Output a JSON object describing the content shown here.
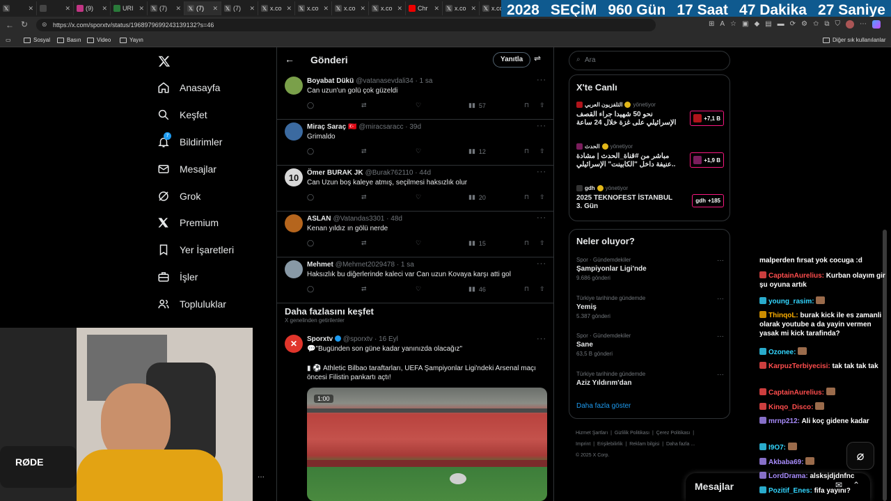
{
  "browser": {
    "tabs": [
      {
        "label": "",
        "icon": "x-logo"
      },
      {
        "label": "",
        "icon": "tabs"
      },
      {
        "label": "(9)",
        "icon": "instagram"
      },
      {
        "label": "URI",
        "icon": "shield"
      },
      {
        "label": "(7)",
        "icon": "x-logo"
      },
      {
        "label": "(7)",
        "icon": "x-logo"
      },
      {
        "label": "(7)",
        "icon": "x-logo"
      },
      {
        "label": "x.co",
        "icon": "x-logo"
      },
      {
        "label": "x.co",
        "icon": "x-logo"
      },
      {
        "label": "x.co",
        "icon": "x-logo"
      },
      {
        "label": "x.co",
        "icon": "x-logo"
      },
      {
        "label": "Chr",
        "icon": "youtube"
      },
      {
        "label": "x.co",
        "icon": "x-logo"
      },
      {
        "label": "x.co",
        "icon": "x-logo"
      }
    ],
    "url": "https://x.com/sporxtv/status/1968979699243139132?s=46",
    "bookmarks": [
      "Sosyal",
      "Basın",
      "Video",
      "Yayın"
    ],
    "other_bookmarks": "Diğer sık kullanılanlar"
  },
  "countdown": {
    "year": "2028",
    "label": "SEÇİM",
    "days": "960 Gün",
    "hours": "17 Saat",
    "minutes": "47 Dakika",
    "seconds": "27 Saniye"
  },
  "nav": {
    "items": [
      {
        "label": "Anasayfa",
        "icon": "home-icon"
      },
      {
        "label": "Keşfet",
        "icon": "search-icon"
      },
      {
        "label": "Bildirimler",
        "icon": "bell-icon",
        "badge": "7"
      },
      {
        "label": "Mesajlar",
        "icon": "mail-icon"
      },
      {
        "label": "Grok",
        "icon": "grok-icon"
      },
      {
        "label": "Premium",
        "icon": "x-premium-icon"
      },
      {
        "label": "Yer İşaretleri",
        "icon": "bookmark-icon"
      },
      {
        "label": "İşler",
        "icon": "briefcase-icon"
      },
      {
        "label": "Topluluklar",
        "icon": "people-icon"
      }
    ]
  },
  "header": {
    "title": "Gönderi",
    "reply_button": "Yanıtla"
  },
  "replies": [
    {
      "name": "Boyabat Dükü",
      "handle": "@vatanasevdali34 · 1 sa",
      "text": "Can uzun'un golü çok güzeldi",
      "views": "57",
      "avatar_color": "#7aa04a"
    },
    {
      "name": "Miraç Saraç",
      "flag": "🇹🇷",
      "handle": "@miracsaracc · 39d",
      "text": "Grimaldo",
      "views": "12",
      "avatar_color": "#3b6aa0"
    },
    {
      "name": "Ömer BURAK JK",
      "handle": "@Burak762110 · 44d",
      "text": "Can Uzun boş kaleye atmış, seçilmesi haksızlık olur",
      "views": "20",
      "avatar_color": "#d8d8d8",
      "avatar_text": "10"
    },
    {
      "name": "ASLAN",
      "handle": "@Vatandas3301 · 48d",
      "text": "Kenan yıldız ın gölü nerde",
      "views": "15",
      "avatar_color": "#b5651d"
    },
    {
      "name": "Mehmet",
      "handle": "@Mehmet2029478 · 1 sa",
      "text": "Haksızlık bu diğerlerinde kaleci var Can uzun Kovaya karşı atti gol",
      "views": "46",
      "avatar_color": "#8899a6"
    }
  ],
  "discover": {
    "title": "Daha fazlasını keşfet",
    "subtitle": "X genelinden getirilenler",
    "post": {
      "name": "Sporxtv",
      "handle": "@sporxtv · 16 Eyl",
      "text1": "💬\"Bugünden son güne kadar yanınızda olacağız\"",
      "text2": "Athletic Bilbao taraftarları, UEFA Şampiyonlar Ligi'ndeki Arsenal maçı öncesi Filistin pankartı açtı!",
      "video_time": "1:00"
    }
  },
  "right": {
    "search_placeholder": "Ara",
    "live_title": "X'te Canlı",
    "live": [
      {
        "source": "التلفزيون العربي",
        "status": "yönetiyor",
        "title": "نحو 50 شهيدا جراء القصف الإسرائيلي على غزة خلال 24 ساعة",
        "count": "+7,1 B"
      },
      {
        "source": "الحدث",
        "status": "yönetiyor",
        "title": "مباشر من #قناة_الحدث | مشادة عنيفة داخل \"الكابينت\" الإسرائيلي..",
        "count": "+1,9 B"
      },
      {
        "source": "gdh",
        "status": "yönetiyor",
        "title": "2025 TEKNOFEST İSTANBUL 3. Gün",
        "count": "+185",
        "badge_text": "gdh"
      }
    ],
    "trends_title": "Neler oluyor?",
    "trends": [
      {
        "category": "Spor · Gündemdekiler",
        "title": "Şampiyonlar Ligi'nde",
        "count": "9.686 gönderi"
      },
      {
        "category": "Türkiye tarihinde gündemde",
        "title": "Yemiş",
        "count": "5.387 gönderi"
      },
      {
        "category": "Spor · Gündemdekiler",
        "title": "Sane",
        "count": "63,5 B gönderi"
      },
      {
        "category": "Türkiye tarihinde gündemde",
        "title": "Aziz Yıldırım'dan",
        "count": ""
      }
    ],
    "show_more": "Daha fazla göster",
    "footer": [
      "Hizmet Şartları",
      "Gizlilik Politikası",
      "Çerez Politikası",
      "Imprint",
      "Erişilebilirlik",
      "Reklam bilgisi",
      "Daha fazla ...",
      "© 2025 X Corp."
    ]
  },
  "messages_drawer": "Mesajlar",
  "chat": [
    {
      "user": "",
      "msg": "malperden fırsat yok cocuga :d",
      "color": "#ffffff"
    },
    {
      "user": "CaptainAurelius:",
      "msg": "Kurban olayım gir şu oyuna artık",
      "color": "#ff4d4d"
    },
    {
      "user": "young_rasim:",
      "msg": "",
      "color": "#33d6ff"
    },
    {
      "user": "ThinqoL:",
      "msg": "burak kick ile es zamanli olarak youtube a da yayin vermen yasak mi kick tarafinda?",
      "color": "#ffb000"
    },
    {
      "user": "Ozonee:",
      "msg": "",
      "color": "#33d6ff"
    },
    {
      "user": "KarpuzTerbiyecisi:",
      "msg": "tak tak tak tak",
      "color": "#ff4d4d"
    },
    {
      "user": "CaptainAurelius:",
      "msg": "",
      "color": "#ff4d4d"
    },
    {
      "user": "Kinqo_Disco:",
      "msg": "",
      "color": "#ff4d4d"
    },
    {
      "user": "mrnp212:",
      "msg": "Ali koç gidene kadar",
      "color": "#a78bfa"
    },
    {
      "user": "I9O7:",
      "msg": "",
      "color": "#33d6ff"
    },
    {
      "user": "Akbaba69:",
      "msg": "",
      "color": "#a78bfa"
    },
    {
      "user": "LordDrama:",
      "msg": "alsksjdjdnfnc",
      "color": "#a78bfa"
    },
    {
      "user": "Pozitif_Enes:",
      "msg": "fifa yayını?",
      "color": "#33d6ff"
    }
  ],
  "webcam": {
    "mic_brand": "RØDE"
  }
}
